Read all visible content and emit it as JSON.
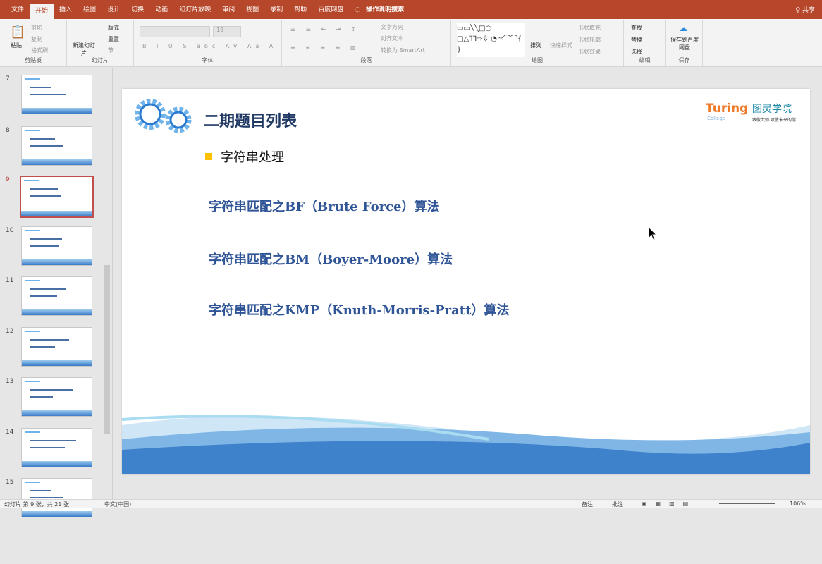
{
  "tabs": [
    "文件",
    "开始",
    "插入",
    "绘图",
    "设计",
    "切换",
    "动画",
    "幻灯片放映",
    "审阅",
    "视图",
    "录制",
    "帮助",
    "百度网盘",
    "操作说明搜索"
  ],
  "share": "共享",
  "ribbon": {
    "clipboard": {
      "paste": "粘贴",
      "cut": "剪切",
      "copy": "复制",
      "format_painter": "格式刷",
      "label": "剪贴板"
    },
    "slides": {
      "new_slide": "新建幻灯片",
      "layout": "版式",
      "reset": "重置",
      "section": "节",
      "label": "幻灯片"
    },
    "font": {
      "size": "18",
      "label": "字体"
    },
    "paragraph": {
      "text_direction": "文字方向",
      "align_text": "对齐文本",
      "smartart": "转换为 SmartArt",
      "label": "段落"
    },
    "drawing": {
      "arrange": "排列",
      "quick_styles": "快速样式",
      "fill": "形状填充",
      "outline": "形状轮廓",
      "effects": "形状效果",
      "label": "绘图"
    },
    "editing": {
      "find": "查找",
      "replace": "替换",
      "select": "选择",
      "label": "编辑"
    },
    "save": {
      "save_baidu": "保存到百度网盘",
      "label": "保存"
    }
  },
  "thumbnails": [
    "7",
    "8",
    "9",
    "10",
    "11",
    "12",
    "13",
    "14",
    "15"
  ],
  "slide": {
    "title": "二期题目列表",
    "bullet": "字符串处理",
    "items": [
      "字符串匹配之BF（Brute Force）算法",
      "字符串匹配之BM（Boyer-Moore）算法",
      "字符串匹配之KMP（Knuth-Morris-Pratt）算法"
    ],
    "logo": {
      "name": "Turing",
      "sub": "College",
      "cn": "图灵学院",
      "slogan": "致敬大师 致敬未来的你"
    }
  },
  "status": {
    "slide_info": "幻灯片 第 9 张，共 21 张",
    "language": "中文(中国)",
    "notes": "备注",
    "comments": "批注",
    "zoom": "106%"
  }
}
